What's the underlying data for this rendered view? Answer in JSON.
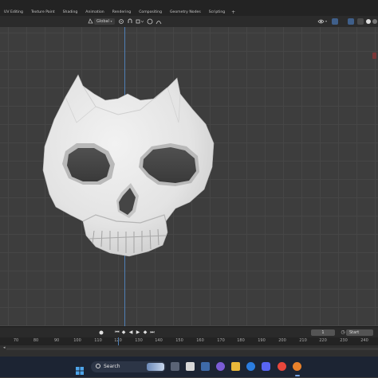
{
  "workspace_tabs": [
    "UV Editing",
    "Texture Paint",
    "Shading",
    "Animation",
    "Rendering",
    "Compositing",
    "Geometry Nodes",
    "Scripting"
  ],
  "add_tab_label": "+",
  "toolbar": {
    "transform_orientation": "Global"
  },
  "timeline": {
    "current_frame": "1",
    "start_label": "Start",
    "ruler_ticks": [
      "70",
      "80",
      "90",
      "100",
      "110",
      "120",
      "130",
      "140",
      "150",
      "160",
      "170",
      "180",
      "190",
      "200",
      "210",
      "220",
      "230",
      "240"
    ]
  },
  "taskbar": {
    "search_label": "Search"
  },
  "colors": {
    "viewport_bg": "#3d3d3d",
    "axis_y": "#4f7fb5",
    "taskbar_bg": "#1c2433"
  }
}
